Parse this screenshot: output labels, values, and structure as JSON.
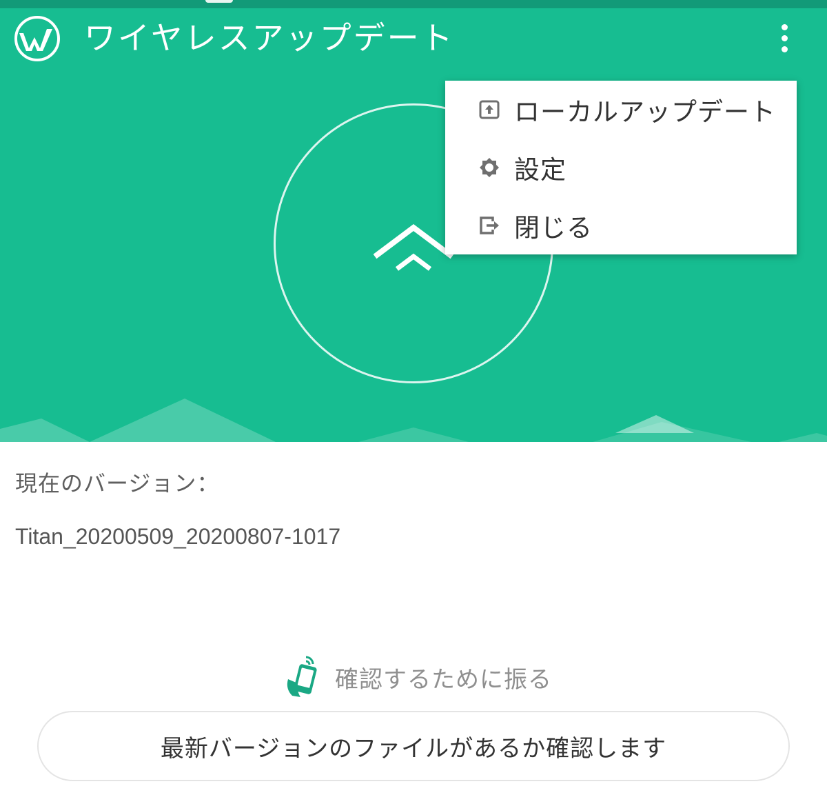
{
  "app_bar": {
    "title": "ワイヤレスアップデート",
    "logo_icon": "wireless-update-logo-icon",
    "overflow_icon": "more-vert-icon"
  },
  "menu": {
    "items": [
      {
        "label": "ローカルアップデート",
        "icon": "local-update-icon"
      },
      {
        "label": "設定",
        "icon": "gear-icon"
      },
      {
        "label": "閉じる",
        "icon": "exit-icon"
      }
    ]
  },
  "main": {
    "version_label": "現在のバージョン：",
    "version_value": "Titan_20200509_20200807-1017",
    "shake_hint": "確認するために振る",
    "check_button_label": "最新バージョンのファイルがあるか確認します"
  },
  "colors": {
    "primary": "#17bd91",
    "status_bar": "#129a78",
    "accent_icon": "#1aa884",
    "text_dark": "#333333",
    "text_muted": "#8f8f8f"
  }
}
